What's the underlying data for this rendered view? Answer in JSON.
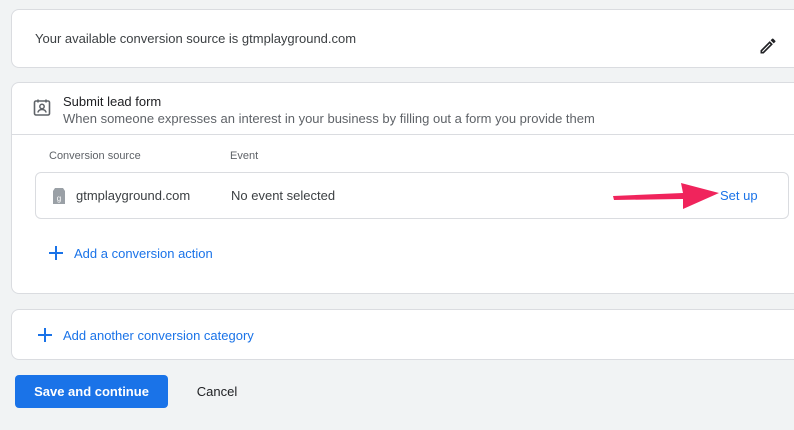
{
  "conversion_source_card": {
    "text": "Your available conversion source is gtmplayground.com",
    "edit_icon": "pencil-icon"
  },
  "lead_form_card": {
    "icon": "contact-form-icon",
    "title": "Submit lead form",
    "description": "When someone expresses an interest in your business by filling out a form you provide them",
    "columns": {
      "source": "Conversion source",
      "event": "Event"
    },
    "row": {
      "icon": "tag-icon",
      "source": "gtmplayground.com",
      "event": "No event selected",
      "action": "Set up"
    },
    "annotation_arrow_color": "#f0245c",
    "add_action_label": "Add a conversion action"
  },
  "add_category_label": "Add another conversion category",
  "footer": {
    "save_label": "Save and continue",
    "cancel_label": "Cancel"
  },
  "colors": {
    "accent": "#1a73e8",
    "background": "#f1f3f4",
    "border": "#dadce0"
  }
}
